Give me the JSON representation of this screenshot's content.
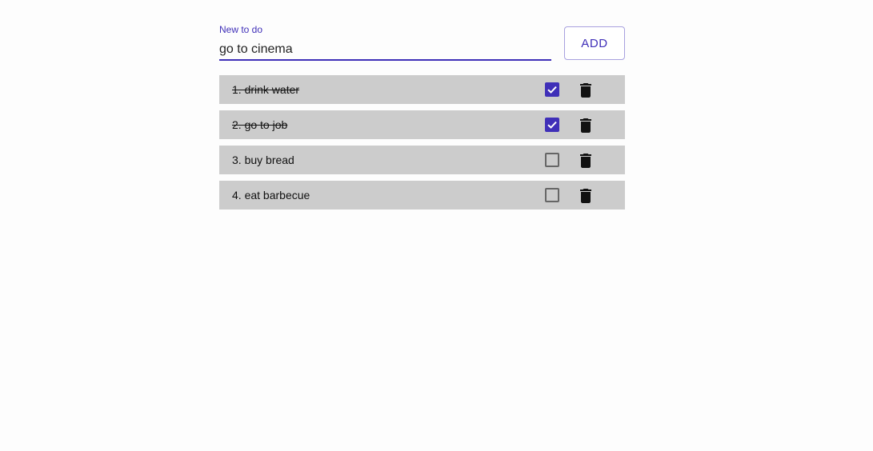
{
  "new_todo": {
    "label": "New to do",
    "value": "go to cinema"
  },
  "add_button": {
    "label": "ADD"
  },
  "todos": [
    {
      "text": "1. drink water",
      "done": true
    },
    {
      "text": "2. go to job",
      "done": true
    },
    {
      "text": "3. buy bread",
      "done": false
    },
    {
      "text": "4. eat barbecue",
      "done": false
    }
  ],
  "colors": {
    "accent": "#3f2fb8",
    "item_background": "#cccccc"
  },
  "icons": {
    "checkbox_checked": "check-icon",
    "delete": "trash-icon"
  }
}
